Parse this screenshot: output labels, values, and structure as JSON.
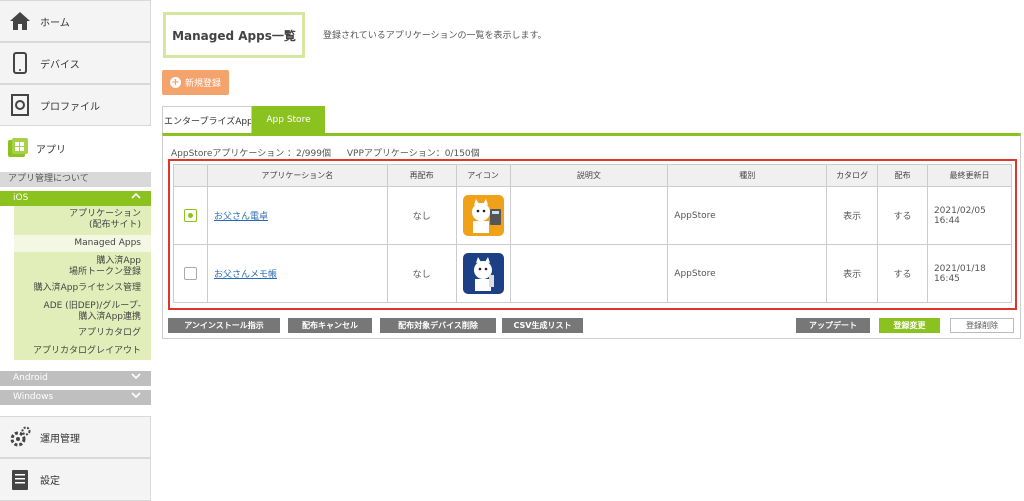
{
  "sidebar": {
    "home": "ホーム",
    "device": "デバイス",
    "profile": "プロファイル",
    "app": "アプリ",
    "about": "アプリ管理について",
    "ios": "iOS",
    "ios_items": [
      "アプリケーション",
      "(配布サイト)",
      "Managed Apps",
      "購入済App",
      "場所トークン登録",
      "購入済Appライセンス管理",
      "ADE (旧DEP)/グループ-",
      "購入済App連携",
      "アプリカタログ",
      "アプリカタログレイアウト"
    ],
    "android": "Android",
    "windows": "Windows",
    "ops": "運用管理",
    "settings": "設定"
  },
  "header": {
    "title": "Managed Apps一覧",
    "description": "登録されているアプリケーションの一覧を表示します。",
    "new_button": "新規登録"
  },
  "tabs": {
    "enterprise": "エンタープライズApp",
    "appstore": "App Store"
  },
  "counts": {
    "appstore": "AppStoreアプリケーション ：2/999個",
    "vpp": "VPPアプリケーション：0/150個"
  },
  "table": {
    "headers": [
      "アプリケーション名",
      "再配布",
      "アイコン",
      "説明文",
      "種別",
      "カタログ",
      "配布",
      "最終更新日"
    ],
    "rows": [
      {
        "name": "お父さん電卓",
        "redistribute": "なし",
        "description": "",
        "kind": "AppStore",
        "catalog": "表示",
        "distribute": "する",
        "date": "2021/02/05",
        "time": "16:44"
      },
      {
        "name": "お父さんメモ帳",
        "redistribute": "なし",
        "description": "",
        "kind": "AppStore",
        "catalog": "表示",
        "distribute": "する",
        "date": "2021/01/18",
        "time": "16:45"
      }
    ]
  },
  "buttons": {
    "uninstall": "アンインストール指示",
    "cancel": "配布キャンセル",
    "remove_target": "配布対象デバイス削除",
    "csv": "CSV生成リスト",
    "update": "アップデート",
    "change": "登録変更",
    "delete": "登録削除"
  },
  "colors": {
    "accent": "#8cc21f",
    "highlight": "#e0362a",
    "new_button": "#f5a36d"
  }
}
